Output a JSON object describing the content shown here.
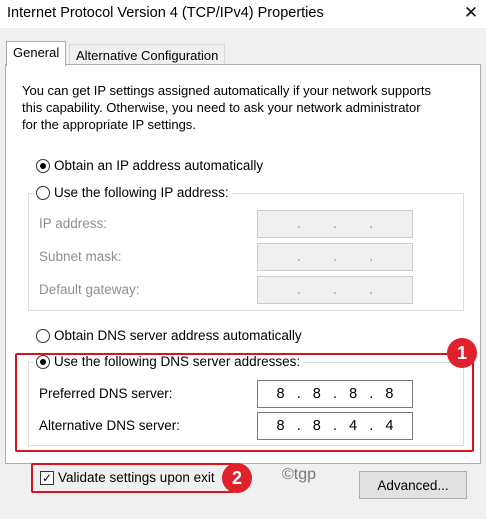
{
  "window": {
    "title": "Internet Protocol Version 4 (TCP/IPv4) Properties",
    "close_glyph": "✕"
  },
  "tabs": [
    {
      "label": "General",
      "selected": true
    },
    {
      "label": "Alternative Configuration",
      "selected": false
    }
  ],
  "intro_text": "You can get IP settings assigned automatically if your network supports\nthis capability. Otherwise, you need to ask your network administrator\nfor the appropriate IP settings.",
  "ip_section": {
    "auto_option": {
      "label": "Obtain an IP address automatically",
      "selected": true
    },
    "manual_option": {
      "label": "Use the following IP address:",
      "selected": false
    },
    "fields": [
      {
        "label": "IP address:",
        "value": [
          "",
          "",
          "",
          ""
        ],
        "enabled": false
      },
      {
        "label": "Subnet mask:",
        "value": [
          "",
          "",
          "",
          ""
        ],
        "enabled": false
      },
      {
        "label": "Default gateway:",
        "value": [
          "",
          "",
          "",
          ""
        ],
        "enabled": false
      }
    ]
  },
  "dns_section": {
    "auto_option": {
      "label": "Obtain DNS server address automatically",
      "selected": false
    },
    "manual_option": {
      "label": "Use the following DNS server addresses:",
      "selected": true
    },
    "fields": [
      {
        "label": "Preferred DNS server:",
        "value": [
          "8",
          "8",
          "8",
          "8"
        ],
        "enabled": true
      },
      {
        "label": "Alternative DNS server:",
        "value": [
          "8",
          "8",
          "4",
          "4"
        ],
        "enabled": true
      }
    ]
  },
  "validate_checkbox": {
    "label": "Validate settings upon exit",
    "checked": true,
    "check_glyph": "✓"
  },
  "advanced_button": {
    "label": "Advanced..."
  },
  "annotations": {
    "badge_1": "1",
    "badge_2": "2",
    "watermark": "©tgp",
    "highlight_color": "#d9141c",
    "badge_color": "#e0202a"
  }
}
